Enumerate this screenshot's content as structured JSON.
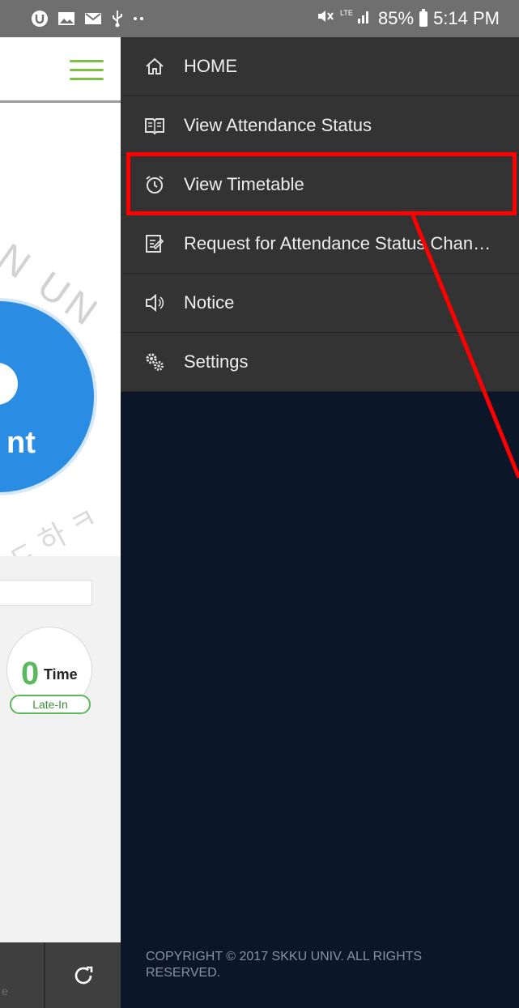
{
  "status_bar": {
    "left_icons": [
      "u-app-icon",
      "image-icon",
      "mail-icon",
      "usb-icon",
      "more-dots-icon"
    ],
    "right_icons": [
      "mute-icon",
      "lte-signal-icon"
    ],
    "battery": "85%",
    "time": "5:14 PM"
  },
  "background_app": {
    "circle_text_fragment": "nt",
    "late_in": {
      "count": "0",
      "unit": "Time",
      "label": "Late-In"
    },
    "bottom_fragment": "e"
  },
  "drawer": {
    "items": [
      {
        "label": "HOME",
        "icon": "home-icon"
      },
      {
        "label": "View Attendance Status",
        "icon": "book-icon"
      },
      {
        "label": "View Timetable",
        "icon": "alarm-clock-icon"
      },
      {
        "label": "Request for Attendance Status Chan…",
        "icon": "edit-note-icon"
      },
      {
        "label": "Notice",
        "icon": "speaker-icon"
      },
      {
        "label": "Settings",
        "icon": "gears-icon"
      }
    ],
    "copyright": "COPYRIGHT © 2017 SKKU UNIV. ALL RIGHTS RESERVED."
  },
  "colors": {
    "status_bar": "#6f6f6f",
    "drawer_menu": "#333333",
    "drawer_bg": "#0b1629",
    "highlight": "#ff0000",
    "accent_green": "#7cc242",
    "circle_blue": "#2b8ce3"
  }
}
